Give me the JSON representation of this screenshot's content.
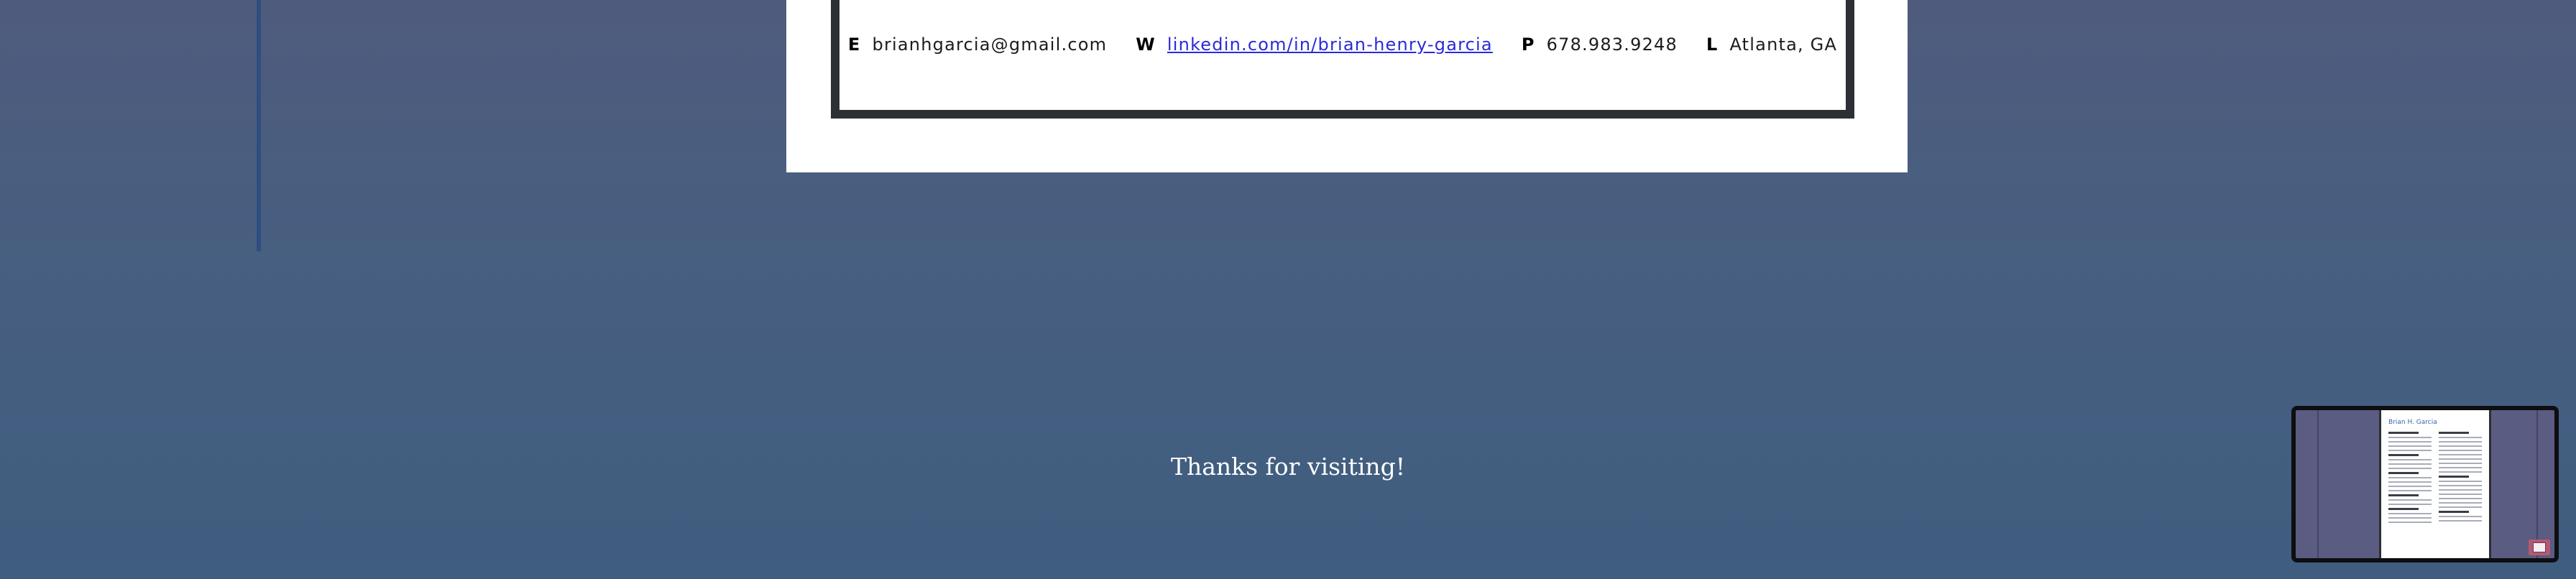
{
  "contact": {
    "email_key": "E",
    "email": "brianhgarcia@gmail.com",
    "web_key": "W",
    "web": "linkedin.com/in/brian-henry-garcia",
    "phone_key": "P",
    "phone": "678.983.9248",
    "location_key": "L",
    "location": "Atlanta, GA"
  },
  "footer": {
    "message": "Thanks for visiting!"
  },
  "minimap": {
    "title": "Brian H. Garcia"
  },
  "colors": {
    "background_top": "#4f5b7d",
    "background_bottom": "#3f5d7f",
    "frame": "#2c2f33",
    "link": "#2a2adb",
    "accent_line": "#2f4e7f"
  }
}
